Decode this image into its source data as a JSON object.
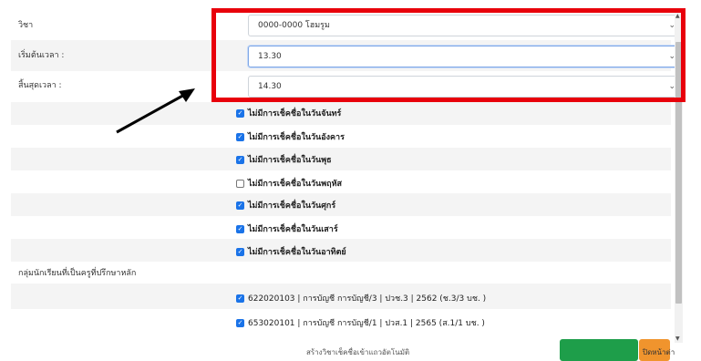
{
  "form": {
    "subject_label": "วิชา",
    "subject_value": "0000-0000 โฮมรูม",
    "start_label": "เริ่มต้นเวลา :",
    "start_value": "13.30",
    "end_label": "สิ้นสุดเวลา :",
    "end_value": "14.30",
    "days": [
      {
        "label": "ไม่มีการเช็คชื่อในวันจันทร์",
        "checked": true
      },
      {
        "label": "ไม่มีการเช็คชื่อในวันอังคาร",
        "checked": true
      },
      {
        "label": "ไม่มีการเช็คชื่อในวันพุธ",
        "checked": true
      },
      {
        "label": "ไม่มีการเช็คชื่อในวันพฤหัส",
        "checked": false
      },
      {
        "label": "ไม่มีการเช็คชื่อในวันศุกร์",
        "checked": true
      },
      {
        "label": "ไม่มีการเช็คชื่อในวันเสาร์",
        "checked": true
      },
      {
        "label": "ไม่มีการเช็คชื่อในวันอาทิตย์",
        "checked": true
      }
    ],
    "group_label": "กลุ่มนักเรียนที่เป็นครูที่ปรึกษาหลัก",
    "groups": [
      {
        "label": "622020103 | การบัญชี การบัญชี/3 | ปวช.3 | 2562 (ช.3/3 บช. )",
        "checked": true
      },
      {
        "label": "653020101 | การบัญชี การบัญชี/1 | ปวส.1 | 2565 (ส.1/1 บช. )",
        "checked": true
      }
    ]
  },
  "footer": {
    "create_text": "สร้างวิชาเช็คชื่อเข้าแถวอัตโนมัติ",
    "close_text": "ปิดหน้าต่าง"
  },
  "icons": {
    "select_chevron": "chevron-down-icon",
    "check": "✓"
  },
  "colors": {
    "highlight": "#e8000b",
    "checkbox": "#1a73e8",
    "save_button": "#1e9e4a",
    "close_button": "#f0942d"
  }
}
